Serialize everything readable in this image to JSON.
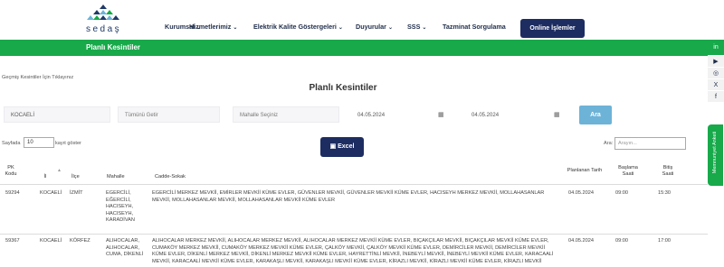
{
  "header": {
    "logo_text": "sedaş",
    "nav": [
      {
        "label": "Kurumsal",
        "has_dropdown": true
      },
      {
        "label": "Hizmetlerimiz",
        "has_dropdown": true
      },
      {
        "label": "Elektrik Kalite Göstergeleri",
        "has_dropdown": true
      },
      {
        "label": "Duyurular",
        "has_dropdown": true
      },
      {
        "label": "SSS",
        "has_dropdown": true
      },
      {
        "label": "Tazminat Sorgulama",
        "has_dropdown": false
      }
    ],
    "online_button": "Online İşlemler"
  },
  "breadcrumb_bar": {
    "title": "Planlı Kesintiler"
  },
  "side_social": [
    "in",
    "▶",
    "◎",
    "X",
    "f"
  ],
  "feedback_tab": "Memnuniyet Anketi",
  "past_link": "Geçmiş Kesintiler İçin Tıklayınız",
  "page_title": "Planlı Kesintiler",
  "filters": {
    "city": "KOCAELİ",
    "district": "Tümünü Getir",
    "neighborhood": "Mahalle Seçiniz",
    "start_date": "04.05.2024",
    "end_date": "04.05.2024",
    "search_button": "Ara"
  },
  "table_controls": {
    "length_prefix": "Sayfada",
    "length_value": "10",
    "length_suffix": "kayıt göster",
    "excel_button": "Excel",
    "search_label": "Ara:",
    "search_placeholder": "Arayın..."
  },
  "table": {
    "columns": [
      "PK Kodu",
      "İl",
      "İlçe",
      "Mahalle",
      "Cadde-Sokak",
      "Planlanan Tarih",
      "Başlama Saati",
      "Bitiş Saati"
    ],
    "rows": [
      {
        "pk": "59294",
        "il": "KOCAELİ",
        "ilce": "İZMİT",
        "mahalle": "EGERCİLİ, EĞERCİLİ, HACISEYH, HACISEYH, KARADİVAN",
        "cadde": "EGERCİLİ MERKEZ MEVKİİ, EMİRLER MEVKİİ KÜME EVLER, GÜVENLER MEVKİİ, GÜVENLER MEVKİİ KÜME EVLER, HACISEYH MERKEZ MEVKİİ, MOLLAHASANLAR MEVKİİ, MOLLAHASANLAR MEVKİİ, MOLLAHASANLAR MEVKİİ KÜME EVLER",
        "tarih": "04.05.2024",
        "baslama": "09:00",
        "bitis": "15:30"
      },
      {
        "pk": "59367",
        "il": "KOCAELİ",
        "ilce": "KÖRFEZ",
        "mahalle": "ALIHOCALAR, ALIHOCALAR, CUMA, DİKENLİ",
        "cadde": "ALIHOCALAR MERKEZ MEVKİİ, ALIHOCALAR MERKEZ MEVKİİ, ALIHOCALAR MERKEZ MEVKİİ KÜME EVLER, BIÇAKÇILAR MEVKİİ, BIÇAKÇILAR MEVKİİ KÜME EVLER, CUMAKÖY MERKEZ MEVKİİ, CUMAKÖY MERKEZ MEVKİİ KÜME EVLER, ÇALKÖY MEVKİİ, ÇALKÖY MEVKİİ KÜME EVLER, DEMİRCİLER MEVKİİ, DEMİRCİLER MEVKİİ KÜME EVLER, DİKENLİ MERKEZ MEVKİİ, DİKENLİ MERKEZ MEVKİİ KÜME EVLER, HAYRETTİNLİ MEVKİİ, İNEBEYLİ MEVKİİ, İNEBEYLİ MEVKİİ KÜME EVLER, KARACAALİ MEVKİİ, KARACAALİ MEVKİİ KÜME EVLER, KARAKAŞLI MEVKİİ, KARAKAŞLI MEVKİİ KÜME EVLER, KİRAZLI MEVKİİ, KİRAZLI MEVKİİ KÜME EVLER, KİRAZLI MEVKİİ",
        "tarih": "04.05.2024",
        "baslama": "09:00",
        "bitis": "17:00"
      }
    ]
  }
}
